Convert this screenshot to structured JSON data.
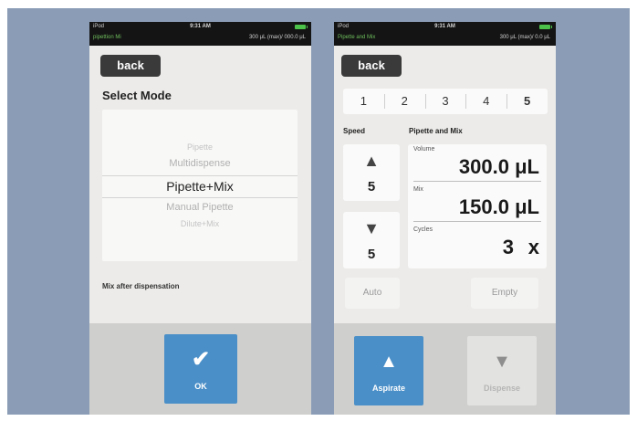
{
  "status": {
    "device": "iPod",
    "time": "9:31 AM"
  },
  "left_screen": {
    "app_label": "pipettion Mi",
    "volume_info": "300 μL (max)/ 000.0 μL",
    "back_label": "back",
    "title": "Select Mode",
    "picker_options": [
      "Pipette",
      "Multidispense",
      "Pipette+Mix",
      "Manual Pipette",
      "Dilute+Mix"
    ],
    "picker_selected": "Pipette+Mix",
    "caption": "Mix after dispensation",
    "ok_label": "OK",
    "ok_icon": "check-icon",
    "accent_color": "#4a8fc8"
  },
  "right_screen": {
    "app_label": "Pipette and Mix",
    "volume_info": "300 μL (max)/ 0.0 μL",
    "back_label": "back",
    "tabs": [
      "1",
      "2",
      "3",
      "4",
      "5"
    ],
    "active_tab": "5",
    "speed_label": "Speed",
    "mode_label": "Pipette and Mix",
    "aspirate_speed": "5",
    "dispense_speed": "5",
    "volume_label": "Volume",
    "volume_value": "300.0 μL",
    "mix_label": "Mix",
    "mix_value": "150.0 μL",
    "cycles_label": "Cycles",
    "cycles_value": "3",
    "cycles_unit": "x",
    "auto_label": "Auto",
    "empty_label": "Empty",
    "aspirate_label": "Aspirate",
    "dispense_label": "Dispense",
    "accent_color": "#4a8fc8",
    "disabled_color": "#e2e2e0"
  }
}
